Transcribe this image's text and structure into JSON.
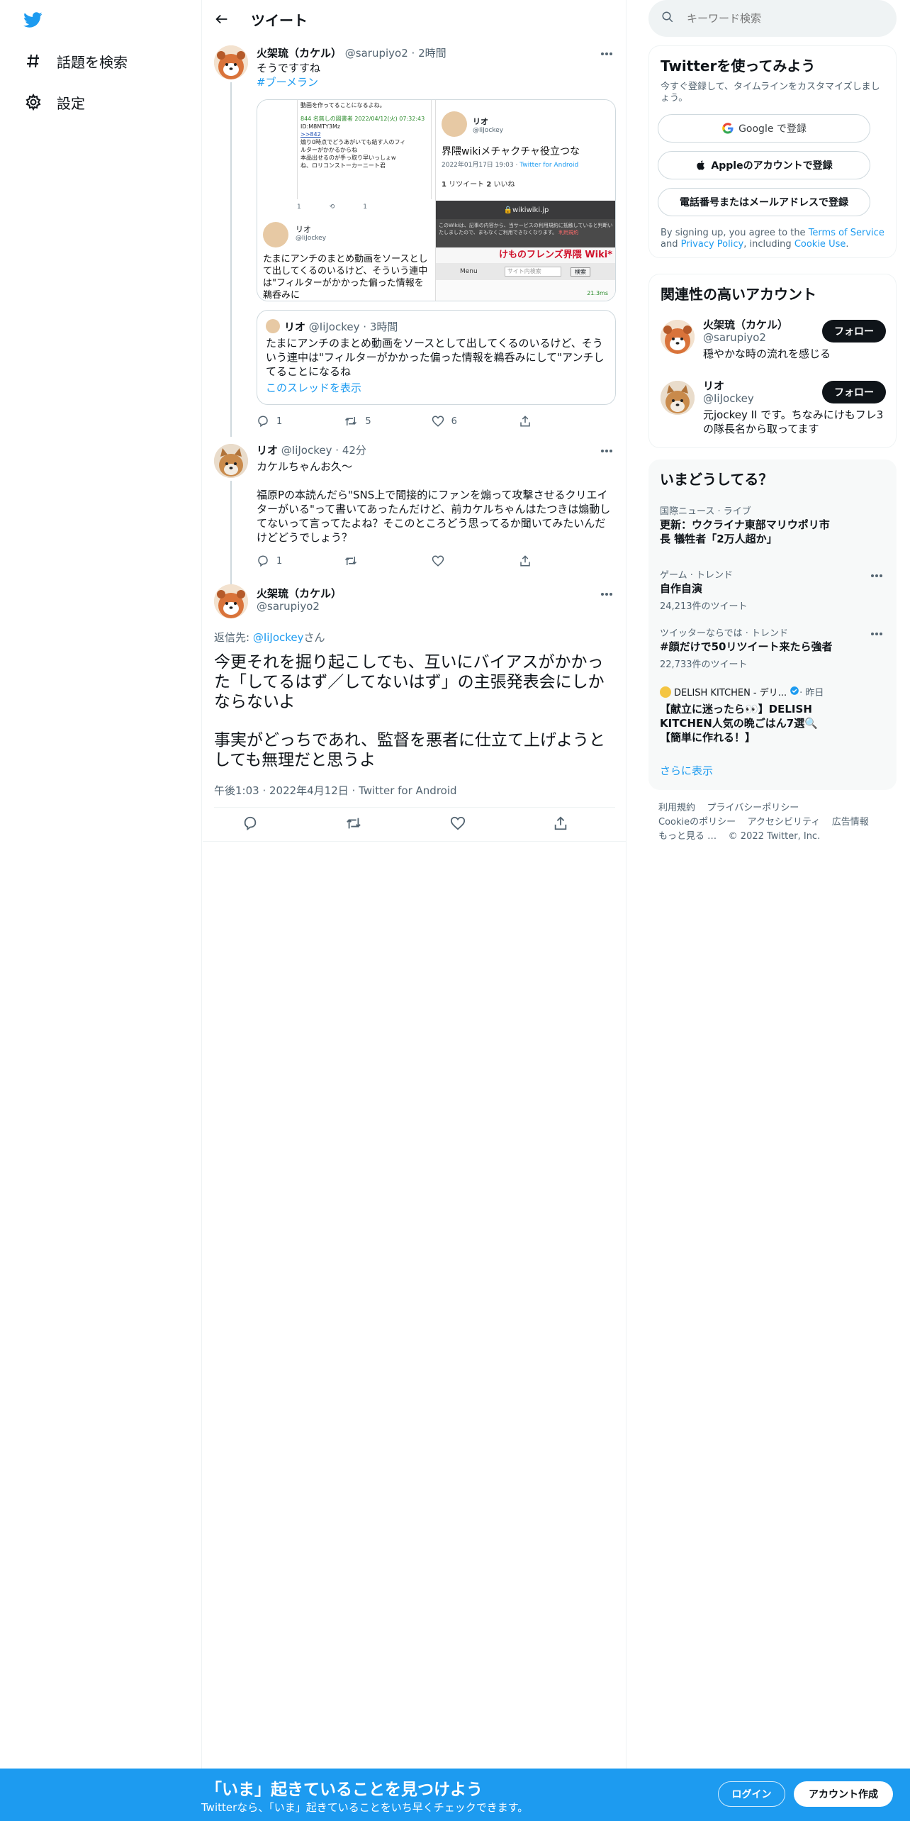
{
  "nav": {
    "explore_label": "話題を検索",
    "settings_label": "設定"
  },
  "main": {
    "header_title": "ツイート"
  },
  "tweet1": {
    "name": "火架琉（カケル）",
    "handle": "@sarupiyo2",
    "time": "2時間",
    "text": "そうですすね",
    "hashtag": "#ブーメラン",
    "media": {
      "left_top_text": "動画を作ってることになるよね。",
      "left_reply_meta": "844 名無しの図書者 2022/04/12(火) 07:32:43",
      "left_reply_id": "ID:M8MTY3Mz",
      "left_reply_ref": ">>842",
      "left_reply_lines": [
        "煽り0時点でどうあがいても結す人のフィ",
        "ルターがかかるからね",
        "本品出せるのが手っ取り早いっしょw",
        "ね、ロリコンストーカーニート君"
      ],
      "left_counts": [
        "1",
        "1"
      ],
      "left_user_name": "リオ",
      "left_user_handle": "@IiJockey",
      "left_bottom_text": "たまにアンチのまとめ動画をソースとして出してくるのいるけど、そういう連中は\"フィルターがかかった偏った情報を鵜呑みに",
      "right_user_name": "リオ",
      "right_user_handle": "@IiJockey",
      "right_title": "界隈wikiメチャクチャ役立つな",
      "right_date": "2022年01月17日 19:03 · ",
      "right_source": "Twitter for Android",
      "right_retweets": "1",
      "right_retweets_label": "リツイート",
      "right_likes": "2",
      "right_likes_label": "いいね",
      "browser_url": "wikiwiki.jp",
      "browser_notice": "このWikiは、記事の内容から、当サービスの利用規約に抵触していると判断いたしましたので、まもなくご利用できなくなります。",
      "browser_notice_link": "利用規約",
      "wiki_banner": "けものフレンズ界隈 Wiki*",
      "wiki_menu": "Menu",
      "wiki_search_placeholder": "サイト内検索",
      "wiki_search_btn": "検索",
      "wiki_status": "21.3ms"
    },
    "quote": {
      "name": "リオ",
      "handle": "@IiJockey",
      "time": "3時間",
      "text": "たまにアンチのまとめ動画をソースとして出してくるのいるけど、そういう連中は\"フィルターがかかった偏った情報を鵜呑みにして\"アンチしてることになるね",
      "thread_link": "このスレッドを表示"
    },
    "replies": "1",
    "retweets": "5",
    "likes": "6"
  },
  "tweet2": {
    "name": "リオ",
    "handle": "@IiJockey",
    "time": "42分",
    "text_line1": "カケルちゃんお久～",
    "text_body": "福原Pの本読んだら\"SNS上で間接的にファンを煽って攻撃させるクリエイターがいる\"って書いてあったんだけど、前カケルちゃんはたつきは煽動してないって言ってたよね？そこのところどう思ってるか聞いてみたいんだけどどうでしょう？",
    "replies": "1"
  },
  "main_tweet": {
    "name": "火架琉（カケル）",
    "handle": "@sarupiyo2",
    "reply_prefix": "返信先: ",
    "reply_to": "@IiJockey",
    "reply_suffix": "さん",
    "text_para1": "今更それを掘り起こしても、互いにバイアスがかかった「してるはず／してないはず」の主張発表会にしかならないよ",
    "text_para2": "事実がどっちであれ、監督を悪者に仕立て上げようとしても無理だと思うよ",
    "meta": "午後1:03 · 2022年4月12日 · Twitter for Android"
  },
  "right": {
    "search_placeholder": "キーワード検索",
    "signup_card": {
      "title": "Twitterを使ってみよう",
      "subtitle": "今すぐ登録して、タイムラインをカスタマイズしましょう。",
      "google_btn": "Google で登録",
      "apple_btn": "Appleのアカウントで登録",
      "phone_btn": "電話番号またはメールアドレスで登録",
      "terms_1": "By signing up, you agree to the ",
      "terms_link1": "Terms of Service",
      "terms_2": " and ",
      "terms_link2": "Privacy Policy",
      "terms_3": ", including ",
      "terms_link3": "Cookie Use",
      "terms_4": "."
    },
    "related": {
      "title": "関連性の高いアカウント",
      "accounts": [
        {
          "name": "火架琉（カケル）",
          "handle": "@sarupiyo2",
          "bio": "穏やかな時の流れを感じる",
          "button": "フォロー"
        },
        {
          "name": "リオ",
          "handle": "@IiJockey",
          "bio": "元jockey II です。ちなみにけもフレ3の隊長名から取ってます",
          "button": "フォロー"
        }
      ]
    },
    "trends": {
      "title": "いまどうしてる？",
      "items": [
        {
          "context": "国際ニュース · ライブ",
          "name": "更新：ウクライナ東部マリウポリ市長 犠牲者「2万人超か」",
          "count": ""
        },
        {
          "context": "ゲーム · トレンド",
          "name": "自作自演",
          "count": "24,213件のツイート"
        },
        {
          "context": "ツイッターならでは · トレンド",
          "name": "#顔だけで50リツイート来たら強者",
          "count": "22,733件のツイート"
        },
        {
          "context_name": "DELISH KITCHEN - デリ...",
          "context_time": " · 昨日",
          "name": "【献立に迷ったら👀】DELISH KITCHEN人気の晩ごはん7選🔍【簡単に作れる！】",
          "count": ""
        }
      ],
      "show_more": "さらに表示"
    },
    "footer": {
      "links": [
        "利用規約",
        "プライバシーポリシー",
        "Cookieのポリシー",
        "アクセシビリティ",
        "広告情報",
        "もっと見る …",
        "© 2022 Twitter, Inc."
      ]
    }
  },
  "banner": {
    "title": "「いま」起きていることを見つけよう",
    "subtitle": "Twitterなら、「いま」起きていることをいち早くチェックできます。",
    "login": "ログイン",
    "signup": "アカウント作成"
  },
  "colors": {
    "accent": "#1d9bf0",
    "text": "#0f1419",
    "secondary": "#536471",
    "border": "#eff3f4"
  }
}
